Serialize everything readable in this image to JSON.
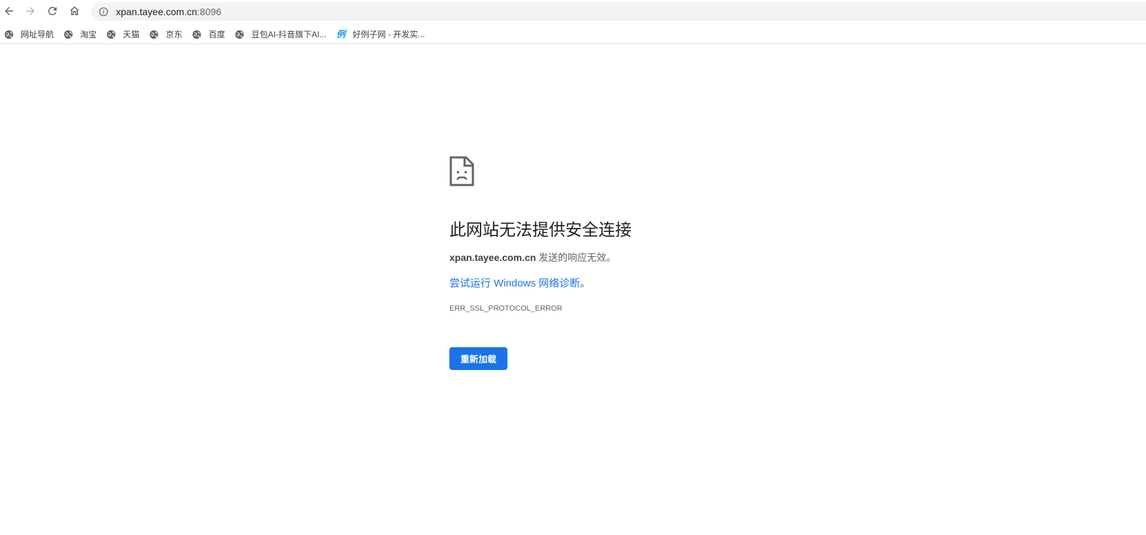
{
  "toolbar": {
    "back_icon": "back-arrow-icon",
    "forward_icon": "forward-arrow-icon",
    "reload_icon": "reload-icon",
    "home_icon": "home-icon",
    "url_host": "xpan.tayee.com.cn",
    "url_port": ":8096",
    "site_info_icon": "info-icon"
  },
  "bookmarks": [
    {
      "label": "网址导航",
      "icon": "globe-icon"
    },
    {
      "label": "淘宝",
      "icon": "globe-icon"
    },
    {
      "label": "天猫",
      "icon": "globe-icon"
    },
    {
      "label": "京东",
      "icon": "globe-icon"
    },
    {
      "label": "百度",
      "icon": "globe-icon"
    },
    {
      "label": "豆包AI-抖音旗下AI...",
      "icon": "globe-icon"
    },
    {
      "label": "好例子网 - 开发实...",
      "icon": "li-site-icon",
      "icon_text": "例"
    }
  ],
  "error": {
    "icon": "sad-page-icon",
    "title": "此网站无法提供安全连接",
    "host": "xpan.tayee.com.cn",
    "description_suffix": " 发送的响应无效。",
    "suggestion_link": "尝试运行 Windows 网络诊断",
    "suggestion_period": "。",
    "error_code": "ERR_SSL_PROTOCOL_ERROR",
    "reload_button": "重新加载"
  },
  "colors": {
    "accent": "#1a73e8",
    "text_primary": "#202124",
    "text_secondary": "#5f6368",
    "omnibox_bg": "#f1f3f4"
  }
}
